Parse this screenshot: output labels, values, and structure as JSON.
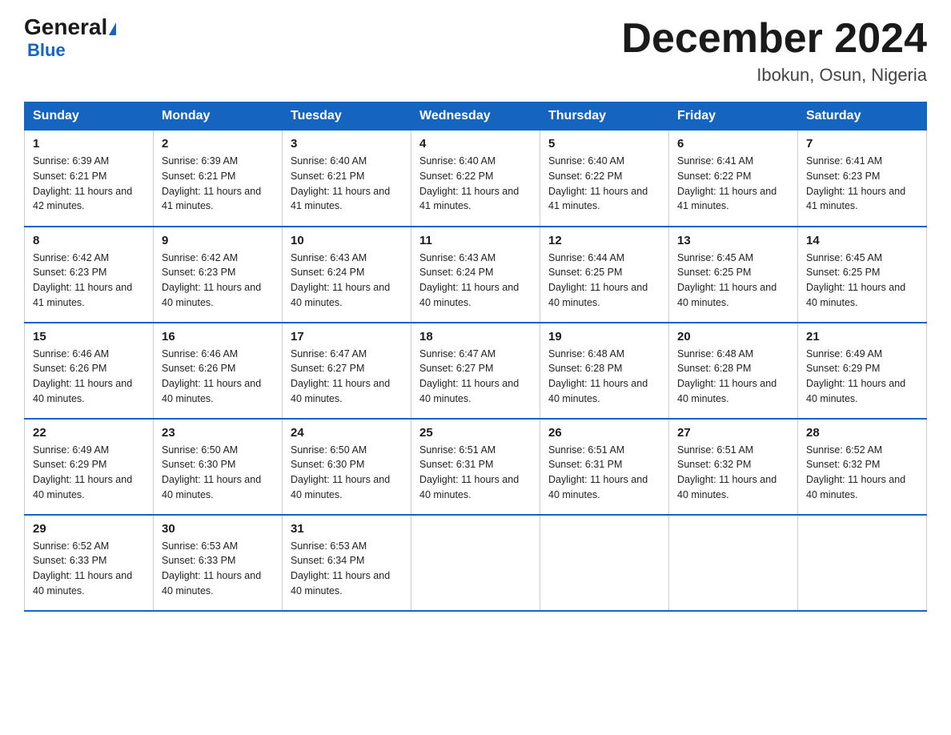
{
  "header": {
    "logo_general": "General",
    "logo_triangle": "▶",
    "logo_blue": "Blue",
    "month_title": "December 2024",
    "location": "Ibokun, Osun, Nigeria"
  },
  "weekdays": [
    "Sunday",
    "Monday",
    "Tuesday",
    "Wednesday",
    "Thursday",
    "Friday",
    "Saturday"
  ],
  "weeks": [
    [
      {
        "day": "1",
        "sunrise": "6:39 AM",
        "sunset": "6:21 PM",
        "daylight": "11 hours and 42 minutes."
      },
      {
        "day": "2",
        "sunrise": "6:39 AM",
        "sunset": "6:21 PM",
        "daylight": "11 hours and 41 minutes."
      },
      {
        "day": "3",
        "sunrise": "6:40 AM",
        "sunset": "6:21 PM",
        "daylight": "11 hours and 41 minutes."
      },
      {
        "day": "4",
        "sunrise": "6:40 AM",
        "sunset": "6:22 PM",
        "daylight": "11 hours and 41 minutes."
      },
      {
        "day": "5",
        "sunrise": "6:40 AM",
        "sunset": "6:22 PM",
        "daylight": "11 hours and 41 minutes."
      },
      {
        "day": "6",
        "sunrise": "6:41 AM",
        "sunset": "6:22 PM",
        "daylight": "11 hours and 41 minutes."
      },
      {
        "day": "7",
        "sunrise": "6:41 AM",
        "sunset": "6:23 PM",
        "daylight": "11 hours and 41 minutes."
      }
    ],
    [
      {
        "day": "8",
        "sunrise": "6:42 AM",
        "sunset": "6:23 PM",
        "daylight": "11 hours and 41 minutes."
      },
      {
        "day": "9",
        "sunrise": "6:42 AM",
        "sunset": "6:23 PM",
        "daylight": "11 hours and 40 minutes."
      },
      {
        "day": "10",
        "sunrise": "6:43 AM",
        "sunset": "6:24 PM",
        "daylight": "11 hours and 40 minutes."
      },
      {
        "day": "11",
        "sunrise": "6:43 AM",
        "sunset": "6:24 PM",
        "daylight": "11 hours and 40 minutes."
      },
      {
        "day": "12",
        "sunrise": "6:44 AM",
        "sunset": "6:25 PM",
        "daylight": "11 hours and 40 minutes."
      },
      {
        "day": "13",
        "sunrise": "6:45 AM",
        "sunset": "6:25 PM",
        "daylight": "11 hours and 40 minutes."
      },
      {
        "day": "14",
        "sunrise": "6:45 AM",
        "sunset": "6:25 PM",
        "daylight": "11 hours and 40 minutes."
      }
    ],
    [
      {
        "day": "15",
        "sunrise": "6:46 AM",
        "sunset": "6:26 PM",
        "daylight": "11 hours and 40 minutes."
      },
      {
        "day": "16",
        "sunrise": "6:46 AM",
        "sunset": "6:26 PM",
        "daylight": "11 hours and 40 minutes."
      },
      {
        "day": "17",
        "sunrise": "6:47 AM",
        "sunset": "6:27 PM",
        "daylight": "11 hours and 40 minutes."
      },
      {
        "day": "18",
        "sunrise": "6:47 AM",
        "sunset": "6:27 PM",
        "daylight": "11 hours and 40 minutes."
      },
      {
        "day": "19",
        "sunrise": "6:48 AM",
        "sunset": "6:28 PM",
        "daylight": "11 hours and 40 minutes."
      },
      {
        "day": "20",
        "sunrise": "6:48 AM",
        "sunset": "6:28 PM",
        "daylight": "11 hours and 40 minutes."
      },
      {
        "day": "21",
        "sunrise": "6:49 AM",
        "sunset": "6:29 PM",
        "daylight": "11 hours and 40 minutes."
      }
    ],
    [
      {
        "day": "22",
        "sunrise": "6:49 AM",
        "sunset": "6:29 PM",
        "daylight": "11 hours and 40 minutes."
      },
      {
        "day": "23",
        "sunrise": "6:50 AM",
        "sunset": "6:30 PM",
        "daylight": "11 hours and 40 minutes."
      },
      {
        "day": "24",
        "sunrise": "6:50 AM",
        "sunset": "6:30 PM",
        "daylight": "11 hours and 40 minutes."
      },
      {
        "day": "25",
        "sunrise": "6:51 AM",
        "sunset": "6:31 PM",
        "daylight": "11 hours and 40 minutes."
      },
      {
        "day": "26",
        "sunrise": "6:51 AM",
        "sunset": "6:31 PM",
        "daylight": "11 hours and 40 minutes."
      },
      {
        "day": "27",
        "sunrise": "6:51 AM",
        "sunset": "6:32 PM",
        "daylight": "11 hours and 40 minutes."
      },
      {
        "day": "28",
        "sunrise": "6:52 AM",
        "sunset": "6:32 PM",
        "daylight": "11 hours and 40 minutes."
      }
    ],
    [
      {
        "day": "29",
        "sunrise": "6:52 AM",
        "sunset": "6:33 PM",
        "daylight": "11 hours and 40 minutes."
      },
      {
        "day": "30",
        "sunrise": "6:53 AM",
        "sunset": "6:33 PM",
        "daylight": "11 hours and 40 minutes."
      },
      {
        "day": "31",
        "sunrise": "6:53 AM",
        "sunset": "6:34 PM",
        "daylight": "11 hours and 40 minutes."
      },
      null,
      null,
      null,
      null
    ]
  ]
}
